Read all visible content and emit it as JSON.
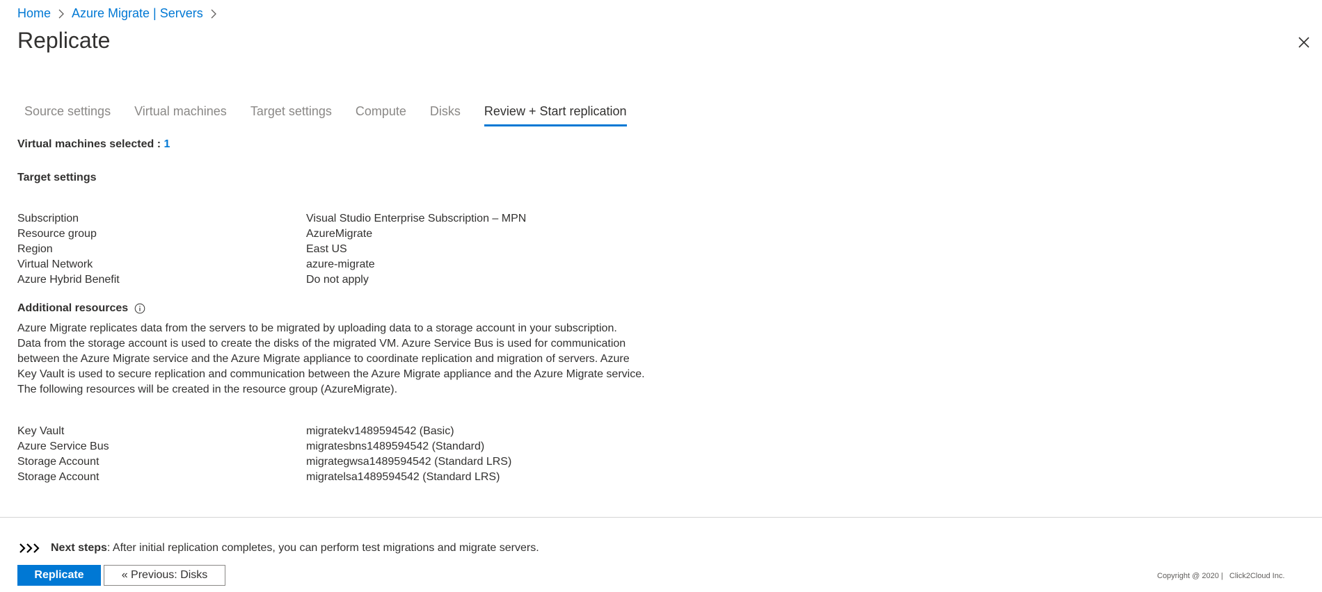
{
  "breadcrumb": {
    "home": "Home",
    "servers": "Azure Migrate | Servers"
  },
  "title": "Replicate",
  "tabs": [
    {
      "label": "Source settings"
    },
    {
      "label": "Virtual machines"
    },
    {
      "label": "Target settings"
    },
    {
      "label": "Compute"
    },
    {
      "label": "Disks"
    },
    {
      "label": "Review + Start replication"
    }
  ],
  "vm_selected": {
    "label": "Virtual machines selected : ",
    "count": "1"
  },
  "target_settings": {
    "heading": "Target settings",
    "rows": [
      {
        "key": "Subscription",
        "value": "Visual Studio Enterprise Subscription – MPN"
      },
      {
        "key": "Resource group",
        "value": "AzureMigrate"
      },
      {
        "key": "Region",
        "value": "East US"
      },
      {
        "key": "Virtual Network",
        "value": "azure-migrate"
      },
      {
        "key": "Azure Hybrid Benefit",
        "value": "Do not apply"
      }
    ]
  },
  "additional_resources": {
    "heading": "Additional resources",
    "description_lines": [
      "Azure Migrate replicates data from the servers to be migrated by uploading data to a storage account in your subscription.",
      "Data from the storage account is used to create the disks of the migrated VM. Azure Service Bus is used for communication",
      "between the Azure Migrate service and the Azure Migrate appliance to coordinate replication and migration of servers. Azure",
      "Key Vault is used to secure replication and communication between the Azure Migrate appliance and the Azure Migrate service.",
      "The following resources will be created in the resource group (AzureMigrate)."
    ],
    "rows": [
      {
        "key": "Key Vault",
        "value": "migratekv1489594542 (Basic)"
      },
      {
        "key": "Azure Service Bus",
        "value": "migratesbns1489594542 (Standard)"
      },
      {
        "key": "Storage Account",
        "value": "migrategwsa1489594542 (Standard LRS)"
      },
      {
        "key": "Storage Account",
        "value": "migratelsa1489594542 (Standard LRS)"
      }
    ]
  },
  "next_steps": {
    "label": "Next steps",
    "text": ": After initial replication completes, you can perform test migrations and migrate servers."
  },
  "buttons": {
    "replicate": "Replicate",
    "previous": "« Previous: Disks"
  },
  "copyright": "Copyright @ 2020 |   Click2Cloud Inc.",
  "colors": {
    "accent": "#0078d4",
    "text": "#323130",
    "muted": "#8a8886"
  }
}
